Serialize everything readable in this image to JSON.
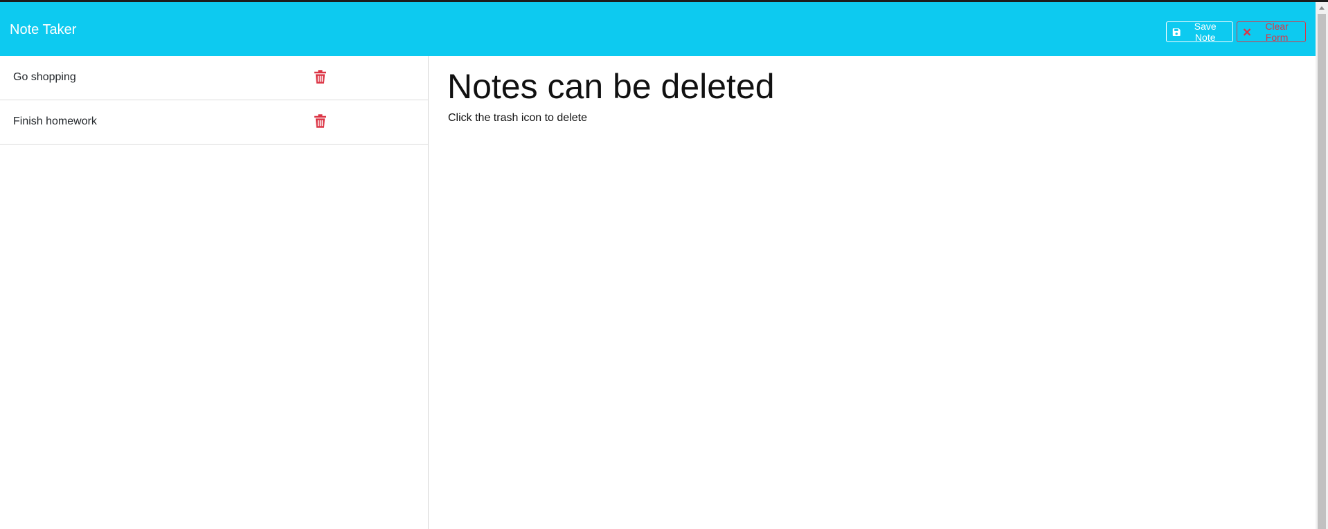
{
  "app": {
    "title": "Note Taker"
  },
  "toolbar": {
    "save_label": "Save Note",
    "clear_label": "Clear Form"
  },
  "notes": [
    {
      "title": "Go shopping"
    },
    {
      "title": "Finish homework"
    }
  ],
  "active_note": {
    "title": "Notes can be deleted",
    "text": "Click the trash icon to delete"
  },
  "colors": {
    "navbar": "#0dcaf0",
    "danger": "#dc3545",
    "text": "#111111"
  },
  "icons": {
    "save": "floppy-disk-icon",
    "clear": "x-icon",
    "delete": "trash-icon"
  }
}
